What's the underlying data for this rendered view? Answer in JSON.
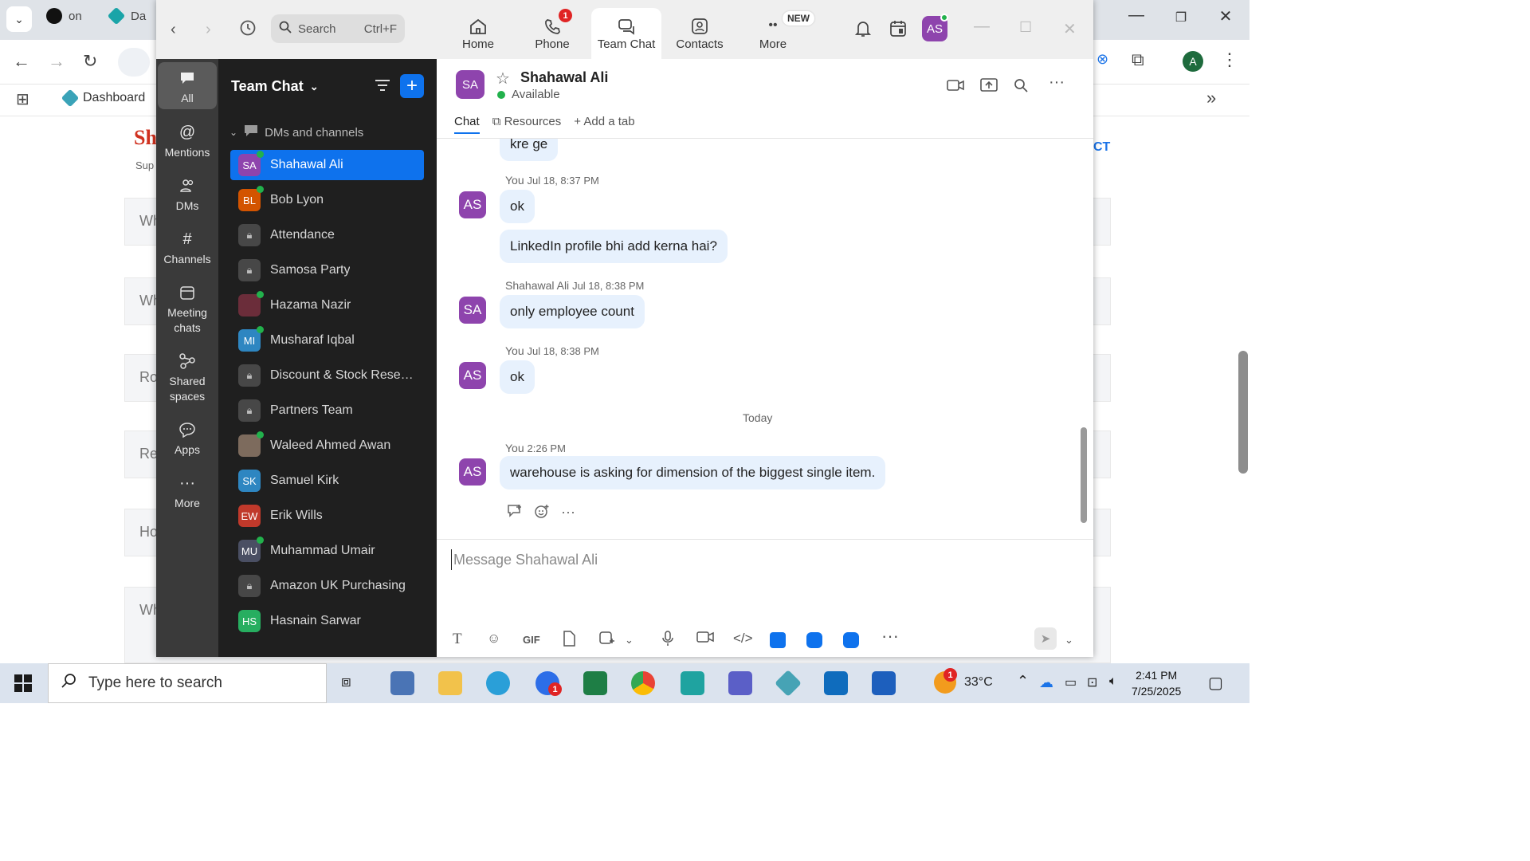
{
  "browser": {
    "tab1_label": "on",
    "tab2_label": "Da",
    "bookmark_label": "Dashboard",
    "profile_initial": "A",
    "left_fragment_brand": "Sh",
    "left_fragment_sub": "Sup",
    "right_fragment": "CT",
    "row_fragments": [
      "Wh",
      "Wh",
      "Ro",
      "Re",
      "Ho",
      "Wh"
    ]
  },
  "zoom": {
    "search": {
      "placeholder": "Search",
      "shortcut": "Ctrl+F"
    },
    "nav_tabs": [
      {
        "label": "Home",
        "icon": "home-icon"
      },
      {
        "label": "Phone",
        "icon": "phone-icon",
        "badge": "1"
      },
      {
        "label": "Team Chat",
        "icon": "chat-icon",
        "active": true
      },
      {
        "label": "Contacts",
        "icon": "contacts-icon"
      },
      {
        "label": "More",
        "icon": "more-icon",
        "badge": "NEW"
      }
    ],
    "user_initials": "AS",
    "rail": [
      {
        "label": "All",
        "icon": "chat-bubble-icon"
      },
      {
        "label": "Mentions",
        "icon": "at-icon"
      },
      {
        "label": "DMs",
        "icon": "people-icon"
      },
      {
        "label": "Channels",
        "icon": "hash-icon"
      },
      {
        "label": "Meeting chats",
        "icon": "calendar-icon"
      },
      {
        "label": "Shared spaces",
        "icon": "share-icon"
      },
      {
        "label": "Apps",
        "icon": "apps-icon"
      },
      {
        "label": "More",
        "icon": "ellipsis-icon"
      }
    ],
    "panel": {
      "title": "Team Chat",
      "section": "DMs and channels",
      "items": [
        {
          "name": "Shahawal Ali",
          "initials": "SA",
          "color": "#8e44ad",
          "online": true,
          "selected": true
        },
        {
          "name": "Bob Lyon",
          "initials": "BL",
          "color": "#d35400",
          "online": true
        },
        {
          "name": "Attendance",
          "lock": true
        },
        {
          "name": "Samosa Party",
          "lock": true
        },
        {
          "name": "Hazama Nazir",
          "initials": "",
          "color": "#6b2d3a",
          "online": true
        },
        {
          "name": "Musharaf Iqbal",
          "initials": "MI",
          "color": "#2e86c1",
          "online": true
        },
        {
          "name": "Discount & Stock Reser...",
          "lock": true
        },
        {
          "name": "Partners Team",
          "lock": true
        },
        {
          "name": "Waleed Ahmed Awan",
          "initials": "",
          "color": "#7d6b5d",
          "online": true
        },
        {
          "name": "Samuel Kirk",
          "initials": "SK",
          "color": "#2e86c1",
          "online": false
        },
        {
          "name": "Erik Wills",
          "initials": "EW",
          "color": "#c0392b",
          "online": false
        },
        {
          "name": "Muhammad Umair",
          "initials": "MU",
          "color": "#4a4f63",
          "online": true
        },
        {
          "name": "Amazon UK Purchasing",
          "lock": true
        },
        {
          "name": "Hasnain Sarwar",
          "initials": "HS",
          "color": "#27ae60",
          "online": false
        }
      ]
    },
    "chat": {
      "contact_initials": "SA",
      "contact_name": "Shahawal Ali",
      "status": "Available",
      "tabs": [
        "Chat",
        "Resources",
        "Add a tab"
      ],
      "today_label": "Today",
      "messages": [
        {
          "text": "kre ge"
        },
        {
          "sender": "You",
          "time": "Jul 18, 8:37 PM",
          "initials": "AS",
          "text": "ok"
        },
        {
          "text": "LinkedIn profile bhi add kerna hai?"
        },
        {
          "sender": "Shahawal Ali",
          "time": "Jul 18, 8:38 PM",
          "initials": "SA",
          "text": "only employee count"
        },
        {
          "sender": "You",
          "time": "Jul 18, 8:38 PM",
          "initials": "AS",
          "text": "ok"
        },
        {
          "sender": "You",
          "time": "2:26 PM",
          "initials": "AS",
          "text": "warehouse is asking for dimension of the biggest single item."
        }
      ],
      "composer_placeholder": "Message Shahawal Ali"
    }
  },
  "taskbar": {
    "search_placeholder": "Type here to search",
    "weather_temp": "33°C",
    "weather_badge": "1",
    "zoom_badge": "1",
    "time": "2:41 PM",
    "date": "7/25/2025"
  },
  "colors": {
    "accent": "#0e72ed",
    "bubble": "#e7f1fd",
    "panel_bg": "#1f1f1f",
    "rail_bg": "#3a3a3a"
  }
}
